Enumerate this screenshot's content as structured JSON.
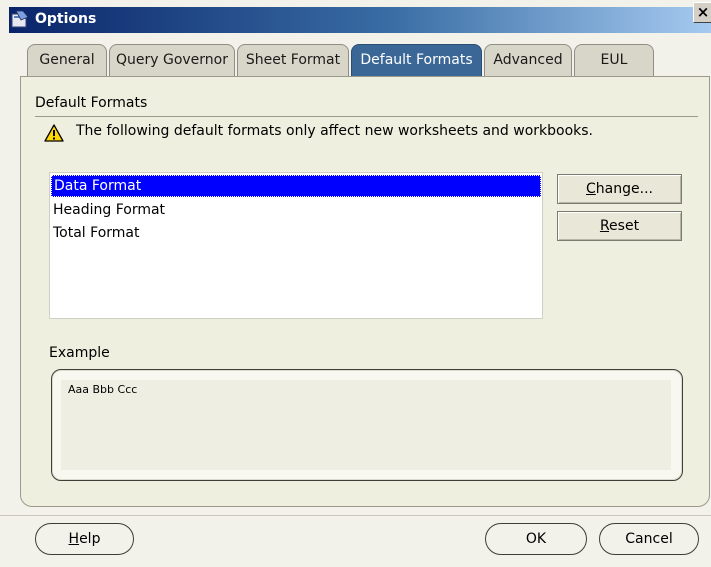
{
  "window": {
    "title": "Options",
    "close_glyph": "×"
  },
  "tabs": [
    {
      "label": "General",
      "active": false
    },
    {
      "label": "Query Governor",
      "active": false
    },
    {
      "label": "Sheet Format",
      "active": false
    },
    {
      "label": "Default Formats",
      "active": true
    },
    {
      "label": "Advanced",
      "active": false
    },
    {
      "label": "EUL",
      "active": false
    }
  ],
  "panel": {
    "group_label": "Default Formats",
    "warning_icon": "warning-icon",
    "warning_text": "The following default formats only affect new worksheets and workbooks.",
    "list_items": [
      {
        "label": "Data Format",
        "selected": true
      },
      {
        "label": "Heading Format",
        "selected": false
      },
      {
        "label": "Total Format",
        "selected": false
      }
    ],
    "change_button": {
      "prefix": "",
      "mnemonic": "C",
      "rest": "hange..."
    },
    "reset_button": {
      "prefix": "",
      "mnemonic": "R",
      "rest": "eset"
    },
    "example_label": "Example",
    "example_text": "Aaa Bbb Ccc"
  },
  "footer": {
    "help_button": {
      "mnemonic": "H",
      "rest": "elp"
    },
    "ok_label": "OK",
    "cancel_label": "Cancel"
  },
  "colors": {
    "title_gradient_start": "#0a246a",
    "title_gradient_end": "#a6caf0",
    "active_tab": "#3a6796",
    "selection": "#0000ff",
    "warning_yellow": "#ffd800"
  }
}
